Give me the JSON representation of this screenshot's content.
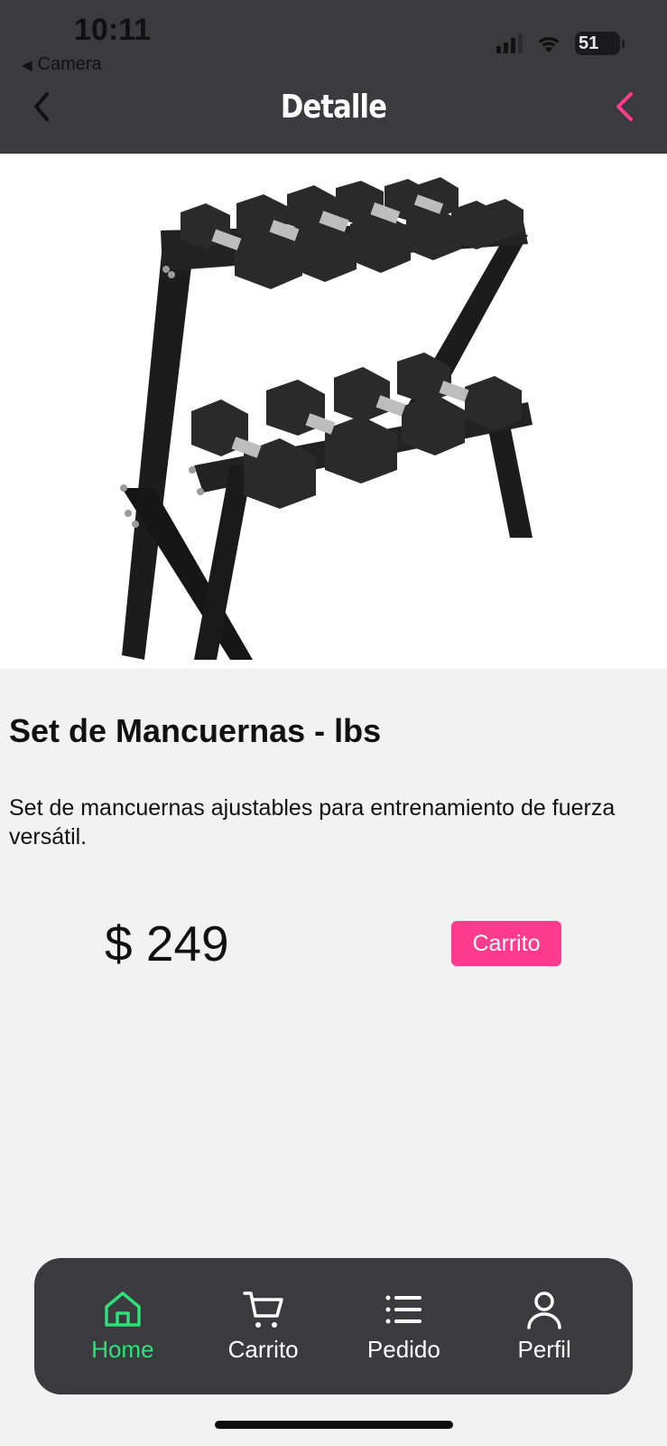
{
  "status_bar": {
    "time": "10:11",
    "back_app_label": "Camera",
    "battery": "51"
  },
  "header": {
    "title": "Detalle",
    "background": "#3b3a3f",
    "accent_color": "#ff3b8d"
  },
  "product": {
    "name": "Set de Mancuernas - lbs",
    "description": "Set de mancuernas ajustables para entrenamiento de fuerza versátil.",
    "price": "$ 249",
    "cart_button_label": "Carrito",
    "image_icon": "dumbbell-rack-image"
  },
  "tabbar": {
    "active_color": "#2ee07a",
    "items": [
      {
        "label": "Home",
        "icon": "home-icon",
        "active": true
      },
      {
        "label": "Carrito",
        "icon": "cart-icon",
        "active": false
      },
      {
        "label": "Pedido",
        "icon": "list-icon",
        "active": false
      },
      {
        "label": "Perfil",
        "icon": "user-icon",
        "active": false
      }
    ]
  }
}
